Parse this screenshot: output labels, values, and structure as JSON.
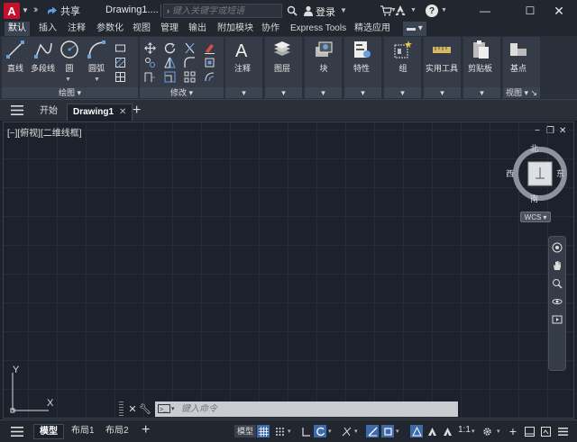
{
  "titlebar": {
    "logo_letter": "A",
    "share_label": "共享",
    "doc_title": "Drawing1....",
    "search_placeholder": "键入关键字或短语",
    "login_label": "登录"
  },
  "ribbon_tabs": [
    {
      "label": "默认",
      "active": true
    },
    {
      "label": "插入"
    },
    {
      "label": "注释"
    },
    {
      "label": "参数化"
    },
    {
      "label": "视图"
    },
    {
      "label": "管理"
    },
    {
      "label": "输出"
    },
    {
      "label": "附加模块"
    },
    {
      "label": "协作"
    },
    {
      "label": "Express Tools"
    },
    {
      "label": "精选应用"
    }
  ],
  "panels": {
    "draw": {
      "label": "绘图",
      "buttons": [
        "直线",
        "多段线",
        "圆",
        "圆弧"
      ]
    },
    "modify": {
      "label": "修改"
    },
    "annotate": {
      "label": "注释"
    },
    "layers": {
      "label": "图层"
    },
    "block": {
      "label": "块"
    },
    "properties": {
      "label": "特性"
    },
    "groups": {
      "label": "组"
    },
    "utilities": {
      "label": "实用工具"
    },
    "clipboard": {
      "label": "剪贴板"
    },
    "view": {
      "label": "视图",
      "base_label": "基点"
    }
  },
  "file_tabs": [
    {
      "label": "开始"
    },
    {
      "label": "Drawing1",
      "active": true,
      "closable": true
    }
  ],
  "canvas": {
    "view_label": "[−][俯视][二维线框]",
    "compass": {
      "north": "北",
      "south": "南",
      "west": "西",
      "east": "东"
    },
    "wcs_label": "WCS",
    "ucs_x": "X",
    "ucs_y": "Y"
  },
  "command_line": {
    "placeholder": "键入命令"
  },
  "statusbar": {
    "layout_tabs": [
      {
        "label": "模型",
        "active": true
      },
      {
        "label": "布局1"
      },
      {
        "label": "布局2"
      }
    ],
    "model_button": "模型",
    "scale": "1:1"
  },
  "colors": {
    "accent": "#3d6aa8",
    "logo": "#c8102e",
    "canvas_bg": "#1c212b"
  }
}
